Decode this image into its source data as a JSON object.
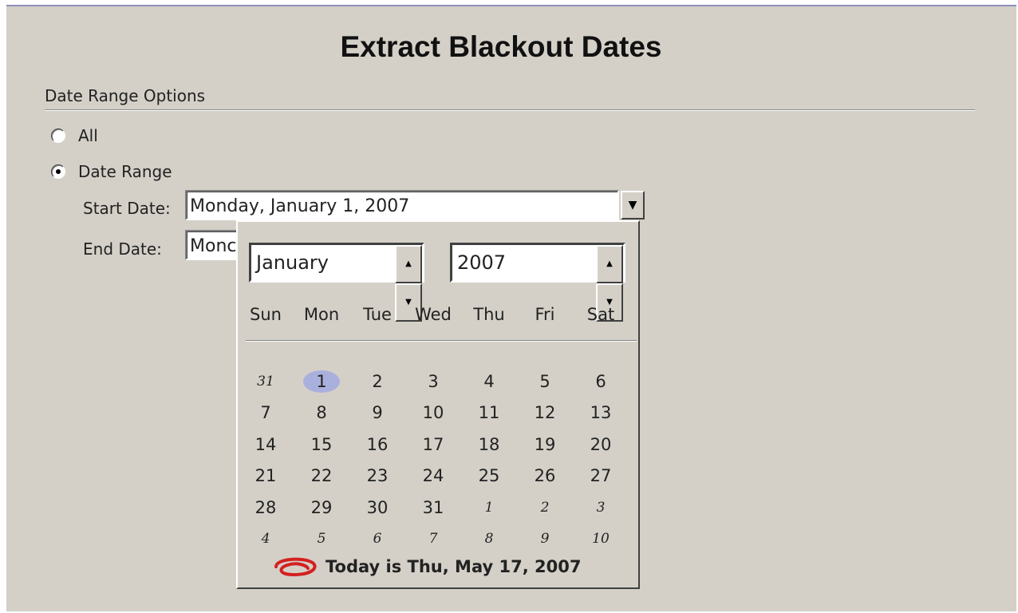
{
  "title": "Extract Blackout Dates",
  "section_label": "Date Range Options",
  "options": {
    "all": "All",
    "date_range": "Date Range",
    "selected": "Date Range"
  },
  "start_date": {
    "label": "Start Date:",
    "value": "Monday, January 1, 2007"
  },
  "end_date": {
    "label": "End Date:",
    "value": "Monc"
  },
  "calendar": {
    "month": "January",
    "year": "2007",
    "weekdays": [
      "Sun",
      "Mon",
      "Tue",
      "Wed",
      "Thu",
      "Fri",
      "Sat"
    ],
    "selected_day": "1",
    "weeks": [
      [
        {
          "d": "31",
          "o": true
        },
        {
          "d": "1",
          "o": false
        },
        {
          "d": "2",
          "o": false
        },
        {
          "d": "3",
          "o": false
        },
        {
          "d": "4",
          "o": false
        },
        {
          "d": "5",
          "o": false
        },
        {
          "d": "6",
          "o": false
        }
      ],
      [
        {
          "d": "7",
          "o": false
        },
        {
          "d": "8",
          "o": false
        },
        {
          "d": "9",
          "o": false
        },
        {
          "d": "10",
          "o": false
        },
        {
          "d": "11",
          "o": false
        },
        {
          "d": "12",
          "o": false
        },
        {
          "d": "13",
          "o": false
        }
      ],
      [
        {
          "d": "14",
          "o": false
        },
        {
          "d": "15",
          "o": false
        },
        {
          "d": "16",
          "o": false
        },
        {
          "d": "17",
          "o": false
        },
        {
          "d": "18",
          "o": false
        },
        {
          "d": "19",
          "o": false
        },
        {
          "d": "20",
          "o": false
        }
      ],
      [
        {
          "d": "21",
          "o": false
        },
        {
          "d": "22",
          "o": false
        },
        {
          "d": "23",
          "o": false
        },
        {
          "d": "24",
          "o": false
        },
        {
          "d": "25",
          "o": false
        },
        {
          "d": "26",
          "o": false
        },
        {
          "d": "27",
          "o": false
        }
      ],
      [
        {
          "d": "28",
          "o": false
        },
        {
          "d": "29",
          "o": false
        },
        {
          "d": "30",
          "o": false
        },
        {
          "d": "31",
          "o": false
        },
        {
          "d": "1",
          "o": true
        },
        {
          "d": "2",
          "o": true
        },
        {
          "d": "3",
          "o": true
        }
      ],
      [
        {
          "d": "4",
          "o": true
        },
        {
          "d": "5",
          "o": true
        },
        {
          "d": "6",
          "o": true
        },
        {
          "d": "7",
          "o": true
        },
        {
          "d": "8",
          "o": true
        },
        {
          "d": "9",
          "o": true
        },
        {
          "d": "10",
          "o": true
        }
      ]
    ],
    "today_text": "Today is Thu, May 17, 2007",
    "today_mark_color": "#d42020"
  }
}
